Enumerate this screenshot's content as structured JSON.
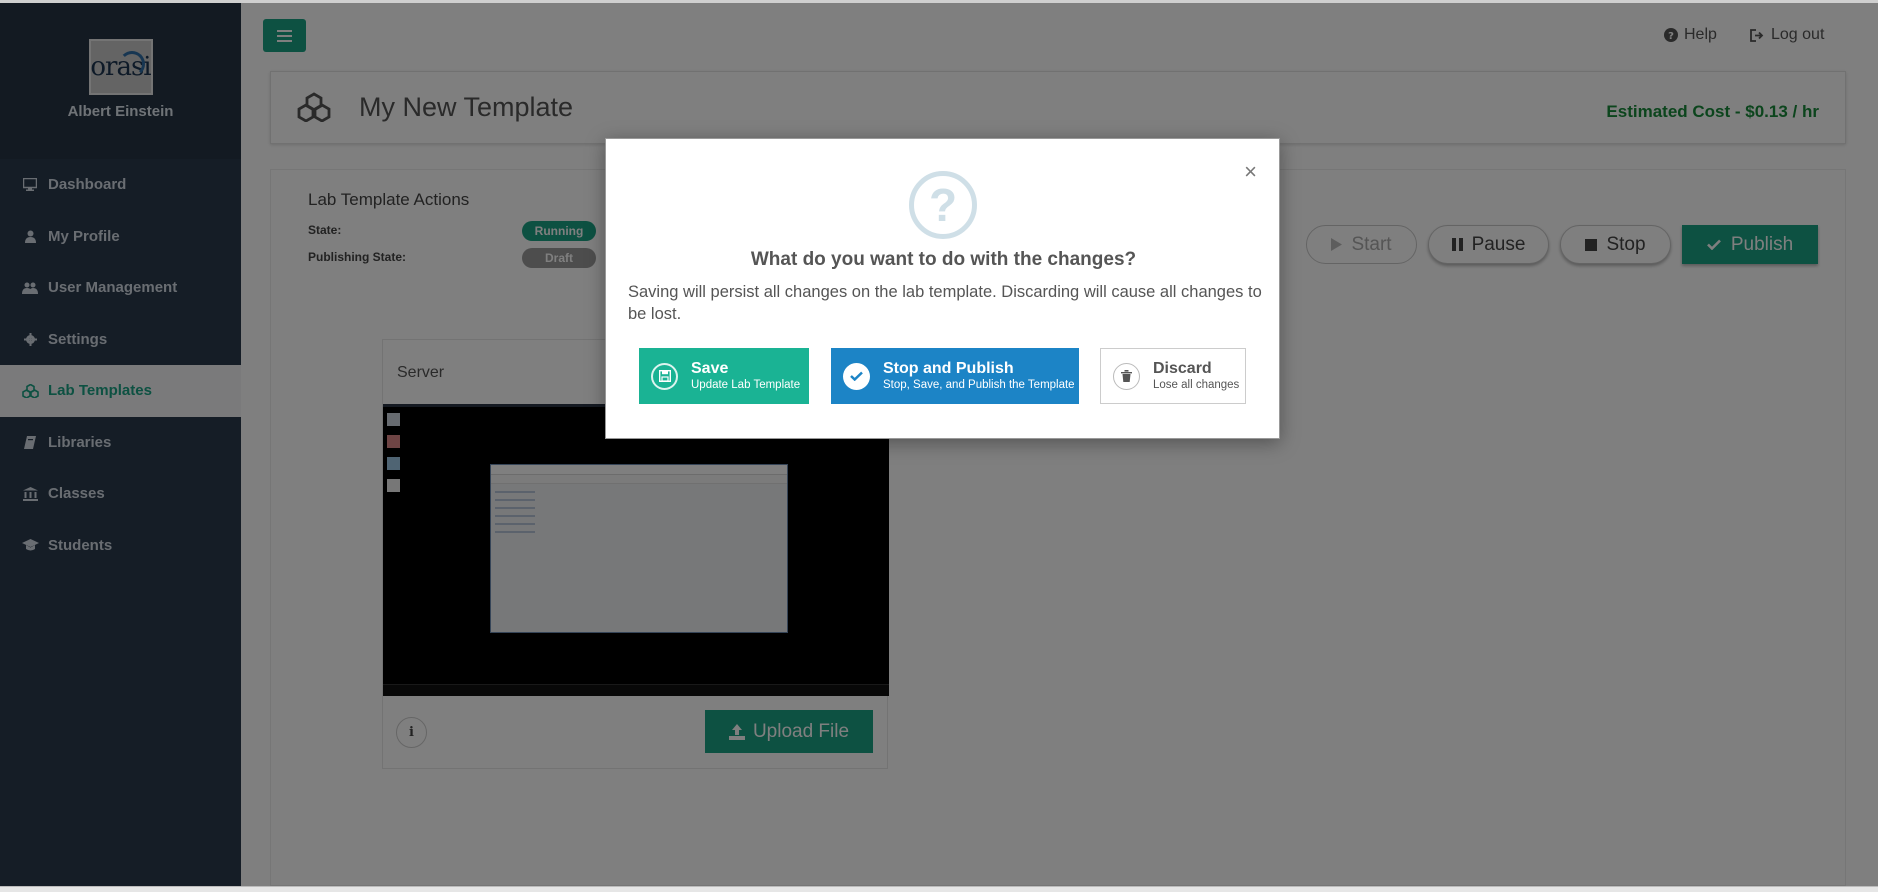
{
  "sidebar": {
    "user_name": "Albert Einstein",
    "logo_text": "orasi",
    "items": [
      {
        "label": "Dashboard",
        "icon": "monitor-icon"
      },
      {
        "label": "My Profile",
        "icon": "user-icon"
      },
      {
        "label": "User Management",
        "icon": "users-icon"
      },
      {
        "label": "Settings",
        "icon": "gear-icon"
      },
      {
        "label": "Lab Templates",
        "icon": "cubes-icon",
        "active": true
      },
      {
        "label": "Libraries",
        "icon": "book-icon"
      },
      {
        "label": "Classes",
        "icon": "bank-icon"
      },
      {
        "label": "Students",
        "icon": "graduation-cap-icon"
      }
    ]
  },
  "header": {
    "help_label": "Help",
    "logout_label": "Log out"
  },
  "page": {
    "title": "My New Template",
    "estimated_cost": "Estimated Cost - $0.13 / hr"
  },
  "actions": {
    "title": "Lab Template Actions",
    "state_label": "State:",
    "state_value": "Running",
    "publishing_label": "Publishing State:",
    "publishing_value": "Draft",
    "start_label": "Start",
    "pause_label": "Pause",
    "stop_label": "Stop",
    "publish_label": "Publish"
  },
  "server": {
    "name": "Server",
    "upload_label": "Upload File",
    "info_label": "i"
  },
  "modal": {
    "title": "What do you want to do with the changes?",
    "body": "Saving will persist all changes on the lab template. Discarding will cause all changes to be lost.",
    "save": {
      "label": "Save",
      "sub": "Update Lab Template"
    },
    "stop_publish": {
      "label": "Stop and Publish",
      "sub": "Stop, Save, and Publish the Template"
    },
    "discard": {
      "label": "Discard",
      "sub": "Lose all changes"
    }
  },
  "colors": {
    "brand": "#1aa284",
    "sidebar_bg": "#2b3b4c",
    "primary_blue": "#1c84c6",
    "cost_green": "#188a3a"
  }
}
